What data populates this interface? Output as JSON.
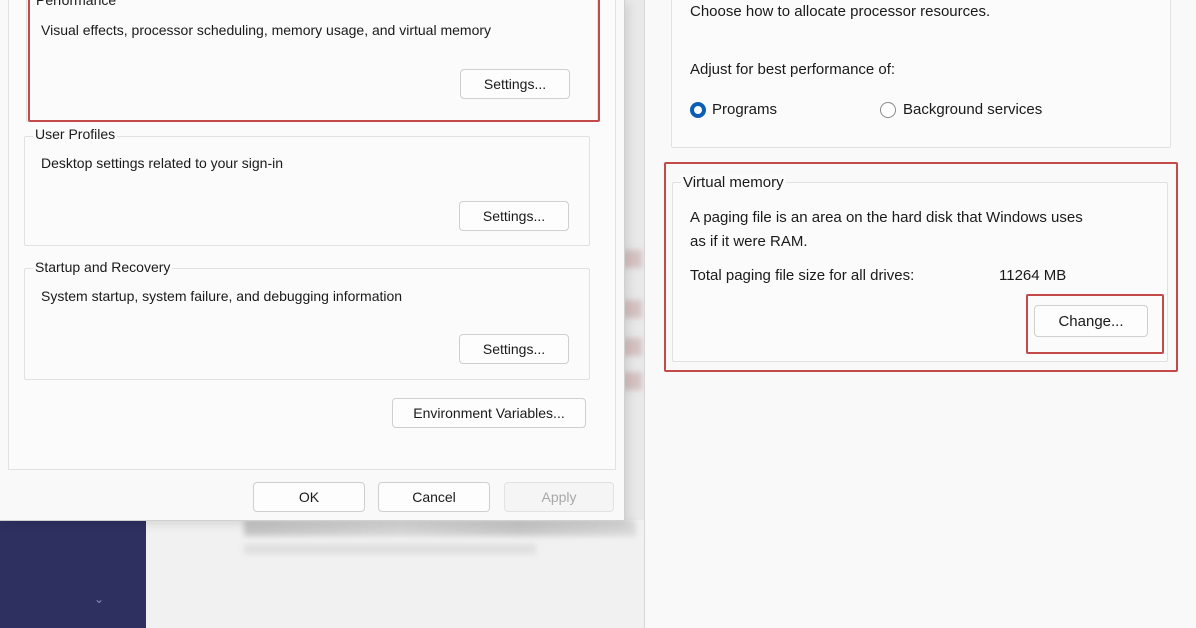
{
  "left_dialog": {
    "performance": {
      "title": "Performance",
      "description": "Visual effects, processor scheduling, memory usage, and virtual memory",
      "settings_label": "Settings..."
    },
    "user_profiles": {
      "title": "User Profiles",
      "description": "Desktop settings related to your sign-in",
      "settings_label": "Settings..."
    },
    "startup_recovery": {
      "title": "Startup and Recovery",
      "description": "System startup, system failure, and debugging information",
      "settings_label": "Settings..."
    },
    "environment_variables_label": "Environment Variables...",
    "footer": {
      "ok_label": "OK",
      "cancel_label": "Cancel",
      "apply_label": "Apply"
    }
  },
  "right_dialog": {
    "processor": {
      "description": "Choose how to allocate processor resources.",
      "adjust_label": "Adjust for best performance of:",
      "options": [
        {
          "label": "Programs",
          "checked": true
        },
        {
          "label": "Background services",
          "checked": false
        }
      ]
    },
    "virtual_memory": {
      "title": "Virtual memory",
      "description_line1": "A paging file is an area on the hard disk that Windows uses",
      "description_line2": "as if it were RAM.",
      "total_label": "Total paging file size for all drives:",
      "total_value": "11264 MB",
      "change_label": "Change..."
    }
  },
  "colors": {
    "highlight": "#c44a4a",
    "radio_accent": "#0a5fb4",
    "background_sidebar": "#2e3060"
  },
  "icons": {
    "background_chevron": "chevron-down-icon"
  }
}
